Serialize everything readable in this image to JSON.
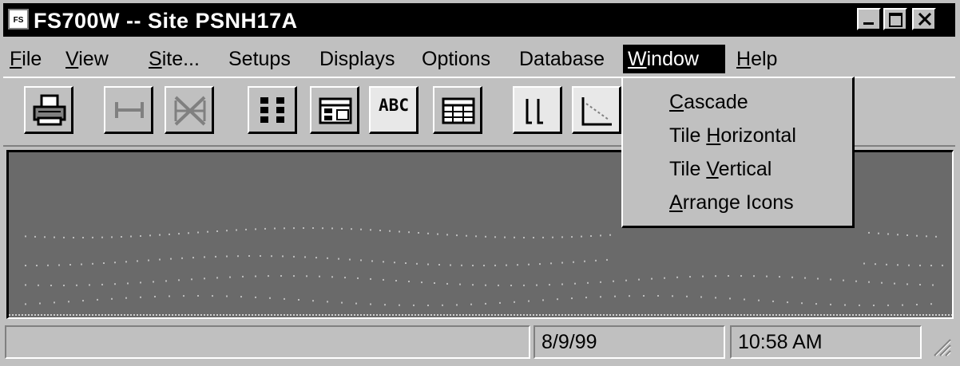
{
  "window": {
    "icon_text": "FS",
    "title": "FS700W -- Site PSNH17A"
  },
  "menubar": {
    "items": [
      {
        "pre": "",
        "u": "F",
        "post": "ile"
      },
      {
        "pre": "",
        "u": "V",
        "post": "iew"
      },
      {
        "pre": "",
        "u": "S",
        "post": "ite..."
      },
      {
        "pre": "Setups",
        "u": "",
        "post": ""
      },
      {
        "pre": "Displays",
        "u": "",
        "post": ""
      },
      {
        "pre": "Options",
        "u": "",
        "post": ""
      },
      {
        "pre": "Database",
        "u": "",
        "post": ""
      },
      {
        "pre": "",
        "u": "W",
        "post": "indow"
      },
      {
        "pre": "",
        "u": "H",
        "post": "elp"
      }
    ]
  },
  "toolbar": {
    "abc_label": "ABC"
  },
  "window_menu": {
    "items": [
      {
        "pre": "",
        "u": "C",
        "post": "ascade"
      },
      {
        "pre": "Tile ",
        "u": "H",
        "post": "orizontal"
      },
      {
        "pre": "Tile ",
        "u": "V",
        "post": "ertical"
      },
      {
        "pre": "",
        "u": "A",
        "post": "rrange Icons"
      }
    ]
  },
  "statusbar": {
    "message": "",
    "date": "8/9/99",
    "time": "10:58 AM"
  },
  "colors": {
    "titlebar": "#000000",
    "chrome": "#c0c0c0",
    "workspace": "#6a6a6a"
  }
}
